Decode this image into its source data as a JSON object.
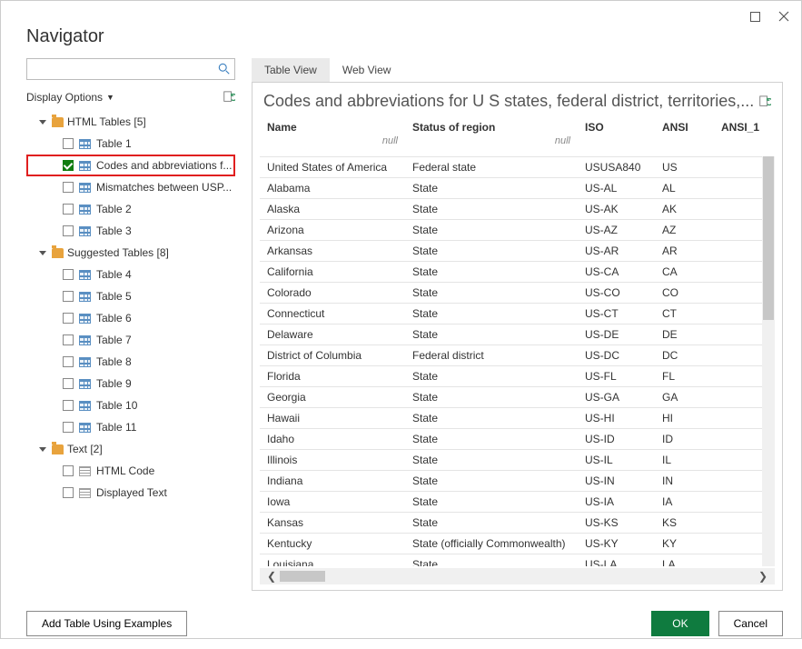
{
  "window": {
    "title": "Navigator"
  },
  "sidebar": {
    "search_placeholder": "",
    "display_options_label": "Display Options",
    "groups": [
      {
        "label": "HTML Tables [5]",
        "items": [
          {
            "label": "Table 1",
            "checked": false
          },
          {
            "label": "Codes and abbreviations f...",
            "checked": true,
            "highlight": true
          },
          {
            "label": "Mismatches between USP...",
            "checked": false
          },
          {
            "label": "Table 2",
            "checked": false
          },
          {
            "label": "Table 3",
            "checked": false
          }
        ]
      },
      {
        "label": "Suggested Tables [8]",
        "items": [
          {
            "label": "Table 4",
            "checked": false
          },
          {
            "label": "Table 5",
            "checked": false
          },
          {
            "label": "Table 6",
            "checked": false
          },
          {
            "label": "Table 7",
            "checked": false
          },
          {
            "label": "Table 8",
            "checked": false
          },
          {
            "label": "Table 9",
            "checked": false
          },
          {
            "label": "Table 10",
            "checked": false
          },
          {
            "label": "Table 11",
            "checked": false
          }
        ]
      },
      {
        "label": "Text [2]",
        "items": [
          {
            "label": "HTML Code",
            "checked": false,
            "icon": "text"
          },
          {
            "label": "Displayed Text",
            "checked": false,
            "icon": "text"
          }
        ]
      }
    ]
  },
  "tabs": {
    "active": "Table View",
    "items": [
      "Table View",
      "Web View"
    ]
  },
  "preview": {
    "title": "Codes and abbreviations for U S states, federal district, territories,...",
    "columns": [
      "Name",
      "Status of region",
      "ISO",
      "ANSI",
      "ANSI_1"
    ],
    "header_null": "null",
    "rows": [
      [
        "United States of America",
        "Federal state",
        "USUSA840",
        "US",
        ""
      ],
      [
        "Alabama",
        "State",
        "US-AL",
        "AL",
        ""
      ],
      [
        "Alaska",
        "State",
        "US-AK",
        "AK",
        ""
      ],
      [
        "Arizona",
        "State",
        "US-AZ",
        "AZ",
        ""
      ],
      [
        "Arkansas",
        "State",
        "US-AR",
        "AR",
        ""
      ],
      [
        "California",
        "State",
        "US-CA",
        "CA",
        ""
      ],
      [
        "Colorado",
        "State",
        "US-CO",
        "CO",
        ""
      ],
      [
        "Connecticut",
        "State",
        "US-CT",
        "CT",
        ""
      ],
      [
        "Delaware",
        "State",
        "US-DE",
        "DE",
        ""
      ],
      [
        "District of Columbia",
        "Federal district",
        "US-DC",
        "DC",
        ""
      ],
      [
        "Florida",
        "State",
        "US-FL",
        "FL",
        ""
      ],
      [
        "Georgia",
        "State",
        "US-GA",
        "GA",
        ""
      ],
      [
        "Hawaii",
        "State",
        "US-HI",
        "HI",
        ""
      ],
      [
        "Idaho",
        "State",
        "US-ID",
        "ID",
        ""
      ],
      [
        "Illinois",
        "State",
        "US-IL",
        "IL",
        ""
      ],
      [
        "Indiana",
        "State",
        "US-IN",
        "IN",
        ""
      ],
      [
        "Iowa",
        "State",
        "US-IA",
        "IA",
        ""
      ],
      [
        "Kansas",
        "State",
        "US-KS",
        "KS",
        ""
      ],
      [
        "Kentucky",
        "State (officially Commonwealth)",
        "US-KY",
        "KY",
        ""
      ],
      [
        "Louisiana",
        "State",
        "US-LA",
        "LA",
        ""
      ]
    ]
  },
  "footer": {
    "add_table_label": "Add Table Using Examples",
    "ok_label": "OK",
    "cancel_label": "Cancel"
  }
}
